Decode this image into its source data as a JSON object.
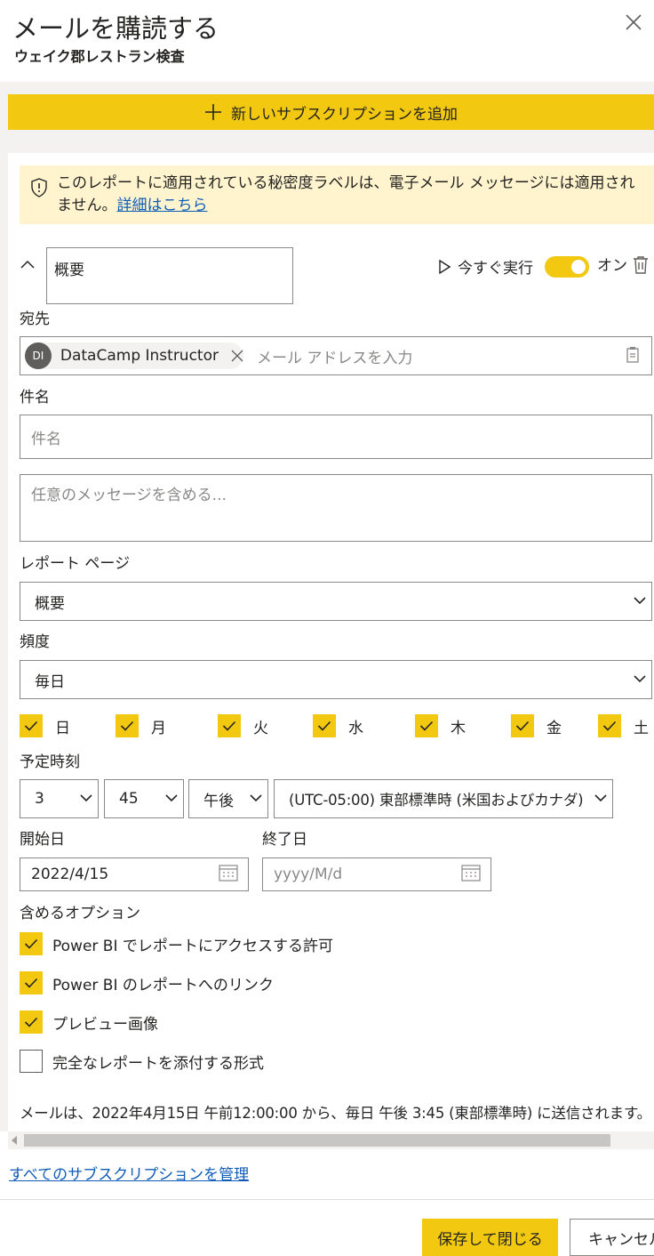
{
  "header": {
    "title": "メールを購読する",
    "subtitle": "ウェイク郡レストラン検査"
  },
  "add_subscription_label": "新しいサブスクリプションを追加",
  "warning": {
    "text": "このレポートに適用されている秘密度ラベルは、電子メール メッセージには適用されません。",
    "link": "詳細はこちら"
  },
  "subscription": {
    "name": "概要",
    "run_now_label": "今すぐ実行",
    "toggle_label": "オン",
    "toggle_on": true
  },
  "to": {
    "label": "宛先",
    "recipient_initials": "DI",
    "recipient_name": "DataCamp Instructor",
    "placeholder": "メール アドレスを入力"
  },
  "subject": {
    "label": "件名",
    "placeholder": "件名"
  },
  "message": {
    "placeholder": "任意のメッセージを含める..."
  },
  "report_page": {
    "label": "レポート ページ",
    "value": "概要"
  },
  "frequency": {
    "label": "頻度",
    "value": "毎日"
  },
  "days": [
    {
      "label": "日",
      "checked": true
    },
    {
      "label": "月",
      "checked": true
    },
    {
      "label": "火",
      "checked": true
    },
    {
      "label": "水",
      "checked": true
    },
    {
      "label": "木",
      "checked": true
    },
    {
      "label": "金",
      "checked": true
    },
    {
      "label": "土",
      "checked": true
    }
  ],
  "schedule": {
    "label": "予定時刻",
    "hour": "3",
    "minute": "45",
    "ampm": "午後",
    "timezone": "(UTC-05:00) 東部標準時 (米国およびカナダ)"
  },
  "start_date": {
    "label": "開始日",
    "value": "2022/4/15"
  },
  "end_date": {
    "label": "終了日",
    "placeholder": "yyyy/M/d"
  },
  "options": {
    "label": "含めるオプション",
    "items": [
      {
        "label": "Power BI でレポートにアクセスする許可",
        "checked": true
      },
      {
        "label": "Power BI のレポートへのリンク",
        "checked": true
      },
      {
        "label": "プレビュー画像",
        "checked": true
      },
      {
        "label": "完全なレポートを添付する形式",
        "checked": false
      }
    ]
  },
  "summary": "メールは、2022年4月15日 午前12:00:00 から、毎日 午後 3:45 (東部標準時) に送信されます。",
  "manage_link": "すべてのサブスクリプションを管理",
  "footer": {
    "save_label": "保存して閉じる",
    "cancel_label": "キャンセル"
  },
  "colors": {
    "accent": "#f2c811",
    "warning_bg": "#fff4ce",
    "link": "#0f5cb8"
  }
}
